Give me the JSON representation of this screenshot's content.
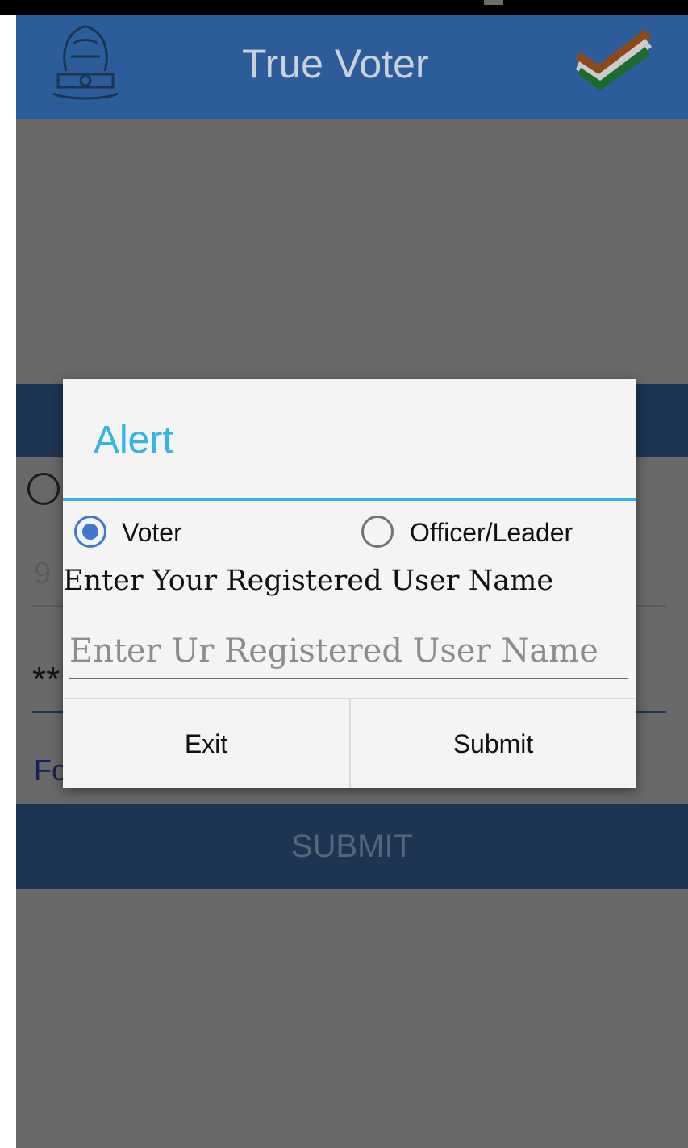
{
  "app_bar": {
    "title": "True Voter",
    "logo_icon": "emblem-icon",
    "check_icon": "tricolor-check-icon"
  },
  "background_form": {
    "phone_partial": "9",
    "password_partial": "**",
    "forgot_partial": "Fo",
    "submit_label": "SUBMIT"
  },
  "dialog": {
    "title": "Alert",
    "radio_options": [
      {
        "label": "Voter",
        "selected": true
      },
      {
        "label": "Officer/Leader",
        "selected": false
      }
    ],
    "prompt": "Enter Your Registered User Name",
    "input": {
      "placeholder": "Enter Ur Registered User Name",
      "value": ""
    },
    "buttons": {
      "exit": "Exit",
      "submit": "Submit"
    }
  },
  "colors": {
    "app_bar": "#2c5d9a",
    "accent": "#33b5e5",
    "radio_selected": "#3f79c8",
    "scrim": "#696969"
  }
}
